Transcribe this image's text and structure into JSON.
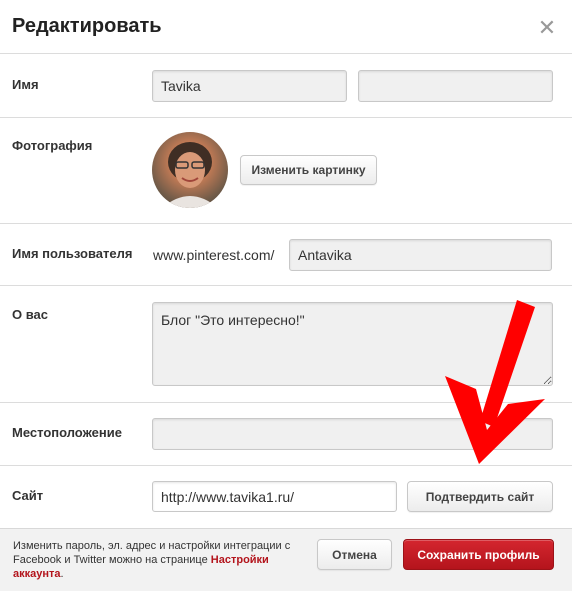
{
  "dialog": {
    "title": "Редактировать"
  },
  "name": {
    "label": "Имя",
    "first_value": "Tavika",
    "last_value": ""
  },
  "photo": {
    "label": "Фотография",
    "change_button": "Изменить картинку"
  },
  "username": {
    "label": "Имя пользователя",
    "prefix": "www.pinterest.com/",
    "value": "Antavika"
  },
  "about": {
    "label": "О вас",
    "value": "Блог \"Это интересно!\""
  },
  "location": {
    "label": "Местоположение",
    "value": ""
  },
  "website": {
    "label": "Сайт",
    "value": "http://www.tavika1.ru/",
    "verify_button": "Подтвердить сайт"
  },
  "footer": {
    "text": "Изменить пароль, эл. адрес и настройки интеграции с Facebook и Twitter можно на странице",
    "link": "Настройки аккаунта",
    "end": ".",
    "cancel_button": "Отмена",
    "save_button": "Сохранить профиль"
  },
  "icons": {
    "close": "close-icon",
    "annotation": "red-arrow"
  },
  "colors": {
    "accent_red": "#c0161e",
    "arrow_red": "#ff0000"
  }
}
